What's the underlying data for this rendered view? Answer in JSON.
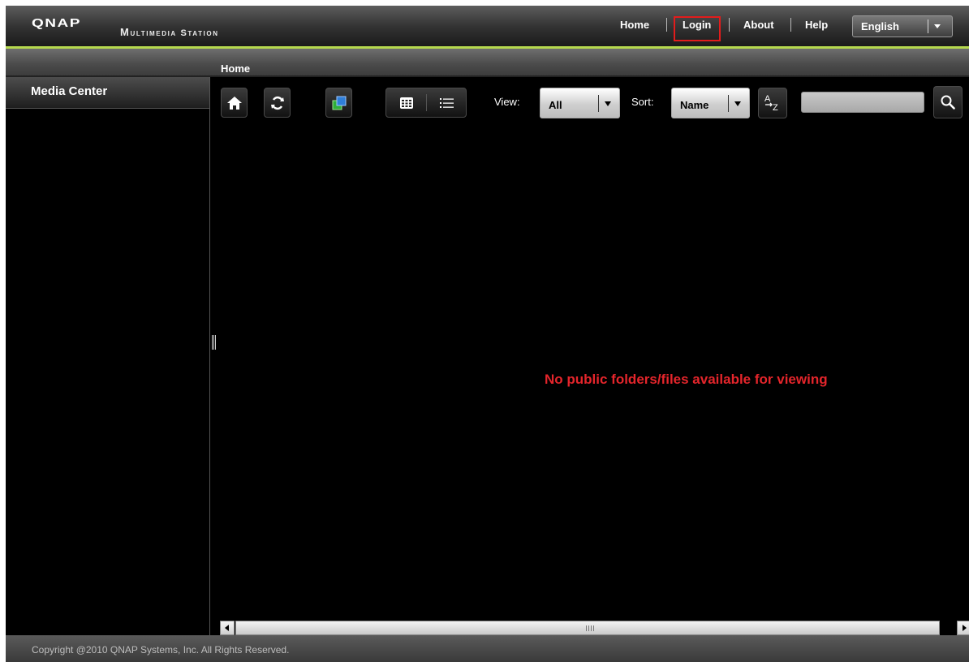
{
  "header": {
    "logo": "QNAP",
    "app_title": "Multimedia Station",
    "links": [
      "Home",
      "Login",
      "About",
      "Help"
    ],
    "language": "English"
  },
  "breadcrumb": "Home",
  "sidebar": {
    "title": "Media Center"
  },
  "toolbar": {
    "view_label": "View:",
    "view_value": "All",
    "sort_label": "Sort:",
    "sort_value": "Name",
    "sort_order_icon": "a-to-z-sort-icon",
    "search_placeholder": ""
  },
  "icons": [
    "home-icon",
    "refresh-icon",
    "slideshow-icon",
    "thumbnail-view-icon",
    "list-view-icon",
    "search-icon"
  ],
  "main": {
    "message": "No public folders/files available for viewing"
  },
  "footer": {
    "copyright": "Copyright @2010 QNAP Systems, Inc. All Rights Reserved."
  },
  "colors": {
    "accent_line": "#b6d94e",
    "message_red": "#e4252b",
    "highlight_box": "#e21c1c",
    "background": "#000000"
  }
}
